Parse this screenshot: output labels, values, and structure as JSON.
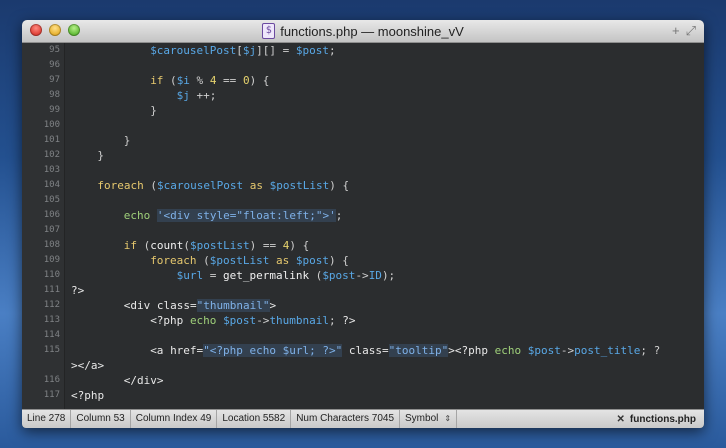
{
  "window": {
    "title": "functions.php — moonshine_vV",
    "doc_icon_glyph": "$"
  },
  "editor": {
    "lines": [
      {
        "n": "95",
        "indent": 12,
        "tokens": [
          [
            "var",
            "$carouselPost"
          ],
          [
            "op",
            "["
          ],
          [
            "var",
            "$j"
          ],
          [
            "op",
            "][] = "
          ],
          [
            "var",
            "$post"
          ],
          [
            "op",
            ";"
          ]
        ]
      },
      {
        "n": "96",
        "indent": 0,
        "tokens": []
      },
      {
        "n": "97",
        "indent": 12,
        "tokens": [
          [
            "kw",
            "if"
          ],
          [
            "op",
            " ("
          ],
          [
            "var",
            "$i"
          ],
          [
            "op",
            " % "
          ],
          [
            "num",
            "4"
          ],
          [
            "op",
            " == "
          ],
          [
            "num",
            "0"
          ],
          [
            "op",
            ") {"
          ]
        ]
      },
      {
        "n": "98",
        "indent": 16,
        "tokens": [
          [
            "var",
            "$j"
          ],
          [
            "op",
            " ++;"
          ]
        ]
      },
      {
        "n": "99",
        "indent": 12,
        "tokens": [
          [
            "op",
            "}"
          ]
        ]
      },
      {
        "n": "100",
        "indent": 0,
        "tokens": []
      },
      {
        "n": "101",
        "indent": 8,
        "tokens": [
          [
            "op",
            "}"
          ]
        ]
      },
      {
        "n": "102",
        "indent": 4,
        "tokens": [
          [
            "op",
            "}"
          ]
        ]
      },
      {
        "n": "103",
        "indent": 0,
        "tokens": []
      },
      {
        "n": "104",
        "indent": 4,
        "tokens": [
          [
            "kw",
            "foreach"
          ],
          [
            "op",
            " ("
          ],
          [
            "var",
            "$carouselPost"
          ],
          [
            "kw",
            " as "
          ],
          [
            "var",
            "$postList"
          ],
          [
            "op",
            ") {"
          ]
        ]
      },
      {
        "n": "105",
        "indent": 0,
        "tokens": []
      },
      {
        "n": "106",
        "indent": 8,
        "tokens": [
          [
            "kwb",
            "echo"
          ],
          [
            "op",
            " "
          ],
          [
            "str",
            "'<div style=\"float:left;\">'"
          ],
          [
            "op",
            ";"
          ]
        ]
      },
      {
        "n": "107",
        "indent": 0,
        "tokens": []
      },
      {
        "n": "108",
        "indent": 8,
        "tokens": [
          [
            "kw",
            "if"
          ],
          [
            "op",
            " ("
          ],
          [
            "fn",
            "count"
          ],
          [
            "op",
            "("
          ],
          [
            "var",
            "$postList"
          ],
          [
            "op",
            ") == "
          ],
          [
            "num",
            "4"
          ],
          [
            "op",
            ") {"
          ]
        ]
      },
      {
        "n": "109",
        "indent": 12,
        "tokens": [
          [
            "kw",
            "foreach"
          ],
          [
            "op",
            " ("
          ],
          [
            "var",
            "$postList"
          ],
          [
            "kw",
            " as "
          ],
          [
            "var",
            "$post"
          ],
          [
            "op",
            ") {"
          ]
        ]
      },
      {
        "n": "110",
        "indent": 16,
        "tokens": [
          [
            "var",
            "$url"
          ],
          [
            "op",
            " = "
          ],
          [
            "fn",
            "get_permalink"
          ],
          [
            "op",
            " ("
          ],
          [
            "var",
            "$post"
          ],
          [
            "op",
            "->"
          ],
          [
            "var",
            "ID"
          ],
          [
            "op",
            ");"
          ]
        ]
      },
      {
        "n": "111",
        "indent": 0,
        "tokens": [
          [
            "tag",
            "?>"
          ]
        ]
      },
      {
        "n": "112",
        "indent": 8,
        "tokens": [
          [
            "tag",
            "<div "
          ],
          [
            "tag",
            "class="
          ],
          [
            "str",
            "\"thumbnail\""
          ],
          [
            "tag",
            ">"
          ]
        ]
      },
      {
        "n": "113",
        "indent": 12,
        "tokens": [
          [
            "tag",
            "<?php "
          ],
          [
            "kwb",
            "echo"
          ],
          [
            "op",
            " "
          ],
          [
            "var",
            "$post"
          ],
          [
            "op",
            "->"
          ],
          [
            "var",
            "thumbnail"
          ],
          [
            "op",
            "; "
          ],
          [
            "tag",
            "?>"
          ]
        ]
      },
      {
        "n": "114",
        "indent": 0,
        "tokens": []
      },
      {
        "n": "115",
        "indent": 12,
        "tokens": [
          [
            "tag",
            "<a "
          ],
          [
            "tag",
            "href="
          ],
          [
            "str",
            "\"<?php echo $url; ?>\""
          ],
          [
            "tag",
            " class="
          ],
          [
            "str",
            "\"tooltip\""
          ],
          [
            "tag",
            ">"
          ],
          [
            "tag",
            "<?php "
          ],
          [
            "kwb",
            "echo"
          ],
          [
            "op",
            " "
          ],
          [
            "var",
            "$post"
          ],
          [
            "op",
            "->"
          ],
          [
            "var",
            "post_title"
          ],
          [
            "op",
            "; ?"
          ]
        ]
      },
      {
        "n": "",
        "indent": 0,
        "tokens": [
          [
            "tag",
            "></a>"
          ]
        ]
      },
      {
        "n": "116",
        "indent": 8,
        "tokens": [
          [
            "tag",
            "</div>"
          ]
        ]
      },
      {
        "n": "117",
        "indent": 0,
        "tokens": [
          [
            "tag",
            "<?php"
          ]
        ]
      }
    ]
  },
  "statusbar": {
    "line": "Line 278",
    "column": "Column 53",
    "column_index": "Column Index 49",
    "location": "Location 5582",
    "num_chars": "Num Characters 7045",
    "symbol": "Symbol",
    "updown_glyph": "⇕",
    "close_glyph": "✕",
    "file": "functions.php"
  },
  "icons": {
    "plus": "+",
    "resize": "⤢"
  },
  "colors": {
    "editor_bg": "#2b2d2f",
    "keyword": "#e6c86e",
    "variable": "#59a8e6",
    "string_bg": "#33404f"
  }
}
